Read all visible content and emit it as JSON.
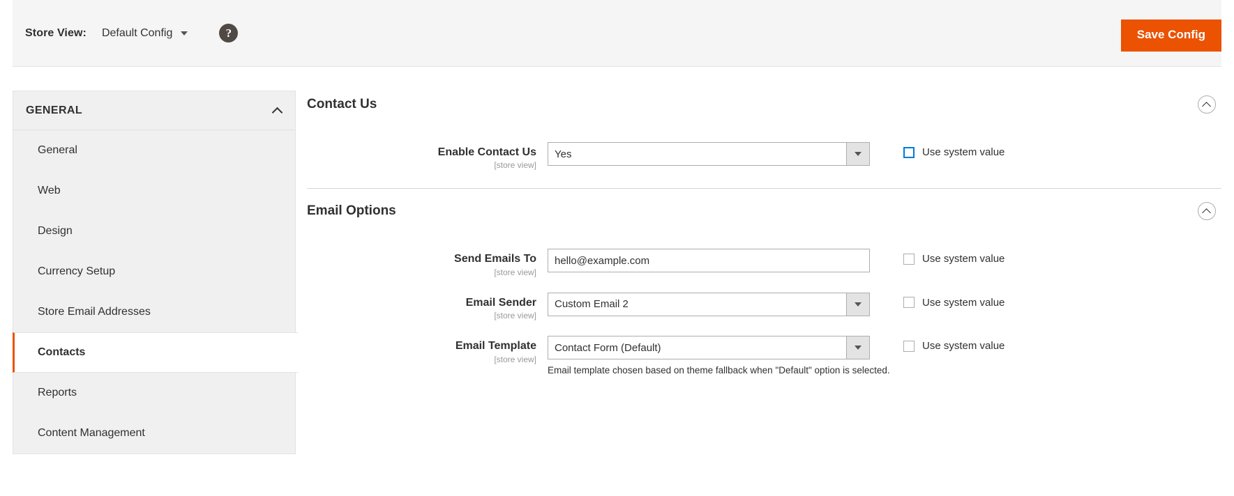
{
  "topbar": {
    "store_view_label": "Store View:",
    "store_view_value": "Default Config",
    "help_icon": "question-mark-help-icon",
    "save_button": "Save Config",
    "accent_color": "#eb5202"
  },
  "sidebar": {
    "group_title": "GENERAL",
    "collapse_icon": "chevron-up-icon",
    "items": [
      {
        "label": "General",
        "active": false
      },
      {
        "label": "Web",
        "active": false
      },
      {
        "label": "Design",
        "active": false
      },
      {
        "label": "Currency Setup",
        "active": false
      },
      {
        "label": "Store Email Addresses",
        "active": false
      },
      {
        "label": "Contacts",
        "active": true
      },
      {
        "label": "Reports",
        "active": false
      },
      {
        "label": "Content Management",
        "active": false
      }
    ]
  },
  "sections": [
    {
      "title": "Contact Us",
      "toggle_icon": "chevron-up-circle-icon",
      "fields": [
        {
          "label": "Enable Contact Us",
          "scope": "[store view]",
          "type": "select",
          "value": "Yes",
          "use_system_label": "Use system value",
          "use_system_checked": false,
          "use_system_focused": true,
          "note": ""
        }
      ]
    },
    {
      "title": "Email Options",
      "toggle_icon": "chevron-up-circle-icon",
      "fields": [
        {
          "label": "Send Emails To",
          "scope": "[store view]",
          "type": "text",
          "value": "hello@example.com",
          "use_system_label": "Use system value",
          "use_system_checked": false,
          "use_system_focused": false,
          "note": ""
        },
        {
          "label": "Email Sender",
          "scope": "[store view]",
          "type": "select",
          "value": "Custom Email 2",
          "use_system_label": "Use system value",
          "use_system_checked": false,
          "use_system_focused": false,
          "note": ""
        },
        {
          "label": "Email Template",
          "scope": "[store view]",
          "type": "select",
          "value": "Contact Form (Default)",
          "use_system_label": "Use system value",
          "use_system_checked": false,
          "use_system_focused": false,
          "note": "Email template chosen based on theme fallback when \"Default\" option is selected."
        }
      ]
    }
  ]
}
